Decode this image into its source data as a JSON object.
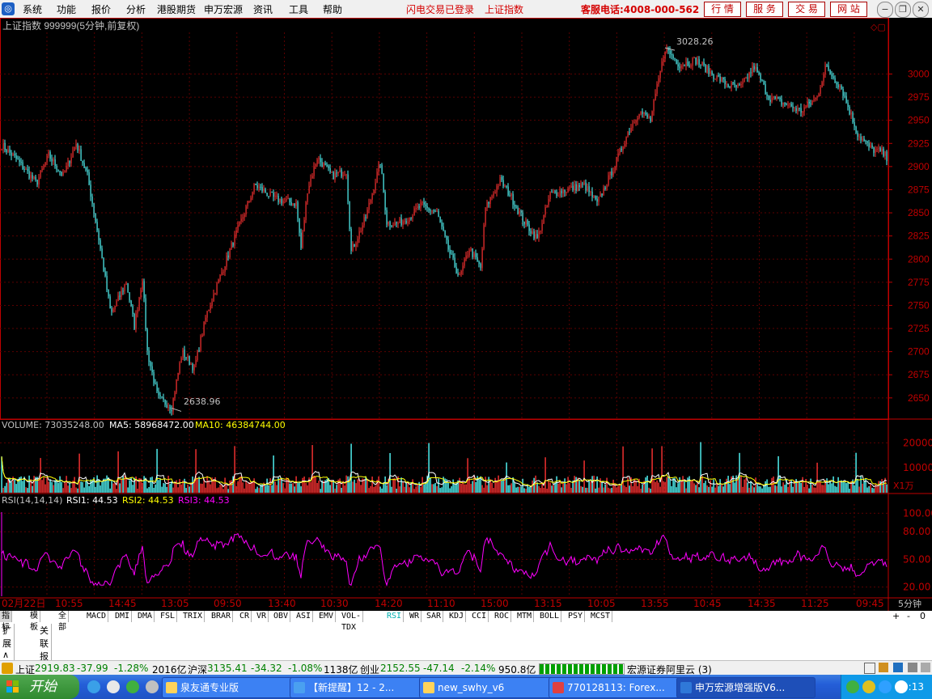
{
  "menubar": {
    "items": [
      "系统",
      "功能",
      "报价",
      "分析",
      "港股期货",
      "申万宏源",
      "资讯",
      "工具",
      "帮助"
    ],
    "notice1": "闪电交易已登录",
    "notice2": "上证指数",
    "hotline": "客服电话:4008-000-562",
    "quick_buttons": [
      "行 情",
      "服 务",
      "交 易",
      "网 站"
    ]
  },
  "chart_header": "上证指数 999999(5分钟,前复权)",
  "colors": {
    "up": "#ff3232",
    "down": "#54fcfc",
    "grid": "#5a0000",
    "axis": "#c00000",
    "rsi": "#ff00ff",
    "ma5": "#ffffff",
    "ma10": "#ffff00"
  },
  "chart_data": [
    {
      "type": "candlestick",
      "title": "上证指数 999999(5分钟,前复权)",
      "ylim": [
        2628,
        3045
      ],
      "yticks": [
        2650,
        2675,
        2700,
        2725,
        2750,
        2775,
        2800,
        2825,
        2850,
        2875,
        2900,
        2925,
        2950,
        2975,
        3000
      ],
      "annotations": [
        {
          "label": "3028.26"
        },
        {
          "label": "2638.96"
        }
      ],
      "path": [
        [
          0,
          2925
        ],
        [
          20,
          2908
        ],
        [
          45,
          2882
        ],
        [
          60,
          2912
        ],
        [
          78,
          2890
        ],
        [
          94,
          2925
        ],
        [
          108,
          2890
        ],
        [
          122,
          2822
        ],
        [
          137,
          2740
        ],
        [
          156,
          2775
        ],
        [
          166,
          2728
        ],
        [
          176,
          2780
        ],
        [
          182,
          2700
        ],
        [
          195,
          2650
        ],
        [
          212,
          2640
        ],
        [
          225,
          2700
        ],
        [
          240,
          2682
        ],
        [
          255,
          2740
        ],
        [
          282,
          2805
        ],
        [
          315,
          2880
        ],
        [
          340,
          2865
        ],
        [
          366,
          2860
        ],
        [
          372,
          2812
        ],
        [
          380,
          2875
        ],
        [
          392,
          2910
        ],
        [
          410,
          2890
        ],
        [
          428,
          2895
        ],
        [
          434,
          2808
        ],
        [
          452,
          2845
        ],
        [
          470,
          2905
        ],
        [
          478,
          2840
        ],
        [
          490,
          2838
        ],
        [
          505,
          2845
        ],
        [
          520,
          2858
        ],
        [
          540,
          2850
        ],
        [
          555,
          2808
        ],
        [
          568,
          2780
        ],
        [
          580,
          2812
        ],
        [
          594,
          2790
        ],
        [
          600,
          2855
        ],
        [
          618,
          2885
        ],
        [
          630,
          2870
        ],
        [
          648,
          2840
        ],
        [
          664,
          2822
        ],
        [
          680,
          2870
        ],
        [
          700,
          2875
        ],
        [
          722,
          2880
        ],
        [
          738,
          2860
        ],
        [
          760,
          2902
        ],
        [
          775,
          2935
        ],
        [
          790,
          2960
        ],
        [
          804,
          2950
        ],
        [
          812,
          2985
        ],
        [
          822,
          3028
        ],
        [
          840,
          3010
        ],
        [
          860,
          3015
        ],
        [
          880,
          3000
        ],
        [
          900,
          2988
        ],
        [
          915,
          2985
        ],
        [
          932,
          3008
        ],
        [
          950,
          2975
        ],
        [
          970,
          2968
        ],
        [
          990,
          2960
        ],
        [
          1010,
          2975
        ],
        [
          1020,
          3008
        ],
        [
          1040,
          2985
        ],
        [
          1060,
          2935
        ],
        [
          1075,
          2920
        ],
        [
          1090,
          2915
        ],
        [
          1096,
          2910
        ]
      ],
      "seed": 7
    },
    {
      "type": "bar",
      "title": "VOLUME",
      "ylabel": "X1万",
      "yticks": [
        10000,
        20000
      ],
      "ylim": [
        0,
        25000
      ],
      "legend": [
        {
          "name": "VOLUME",
          "value": "73035248.00"
        },
        {
          "name": "MA5",
          "value": "58968472.00"
        },
        {
          "name": "MA10",
          "value": "46384744.00"
        }
      ]
    },
    {
      "type": "line",
      "title": "RSI(14,14,14)",
      "ylim": [
        10,
        110
      ],
      "yticks": [
        20,
        50,
        80,
        100
      ],
      "legend": [
        {
          "name": "RSI1",
          "value": "44.53"
        },
        {
          "name": "RSI2",
          "value": "44.53"
        },
        {
          "name": "RSI3",
          "value": "44.53"
        }
      ]
    }
  ],
  "ytick_labels_main": [
    "2650",
    "2675",
    "2700",
    "2725",
    "2750",
    "2775",
    "2800",
    "2825",
    "2850",
    "2875",
    "2900",
    "2925",
    "2950",
    "2975",
    "3000"
  ],
  "ytick_labels_vol": [
    "10000",
    "20000"
  ],
  "ytick_labels_rsi": [
    "20.00",
    "50.00",
    "80.00",
    "100.00"
  ],
  "vol_unit": "X1万",
  "max_label": "3028.26",
  "min_label": "2638.96",
  "vol_legend": {
    "label": "VOLUME: 73035248.00",
    "ma5": "MA5: 58968472.00",
    "ma10": "MA10: 46384744.00"
  },
  "rsi_legend": {
    "label": "RSI(14,14,14)",
    "rsi1": "RSI1: 44.53",
    "rsi2": "RSI2: 44.53",
    "rsi3": "RSI3: 44.53"
  },
  "time_axis": [
    "02月22日",
    "10:55",
    "14:45",
    "13:05",
    "09:50",
    "13:40",
    "10:30",
    "14:20",
    "11:10",
    "15:00",
    "13:15",
    "10:05",
    "13:55",
    "10:45",
    "14:35",
    "11:25",
    "09:45"
  ],
  "period_label": "5分钟",
  "indicator_tabs": [
    "指标",
    "模板",
    "全部",
    "MACD",
    "DMI",
    "DMA",
    "FSL",
    "TRIX",
    "BRAR",
    "CR",
    "VR",
    "OBV",
    "ASI",
    "EMV",
    "VOL-TDX",
    "RSI",
    "WR",
    "SAR",
    "KDJ",
    "CCI",
    "ROC",
    "MTM",
    "BOLL",
    "PSY",
    "MCST"
  ],
  "right_controls": [
    "+",
    "-",
    "0"
  ],
  "subtabs": [
    "扩展∧",
    "关联报价"
  ],
  "status": {
    "sh_name": "上证",
    "sh_val": "2919.83",
    "sh_chg": "-37.99",
    "sh_pct": "-1.28%",
    "sh_amt": "2016亿",
    "hs_name": "沪深",
    "hs_val": "3135.41",
    "hs_chg": "-34.32",
    "hs_pct": "-1.08%",
    "hs_amt": "1138亿",
    "cy_name": "创业",
    "cy_val": "2152.55",
    "cy_chg": "-47.14",
    "cy_pct": "-2.14%",
    "cy_amt": "950.8亿",
    "server": "宏源证券阿里云 (3)"
  },
  "taskbar": {
    "start": "开始",
    "tasks": [
      "泉友通专业版",
      "【新提醒】12 - 2...",
      "new_swhy_v6",
      "770128113: Forex...",
      "申万宏源增强版V6..."
    ],
    "clock": "19:13"
  }
}
